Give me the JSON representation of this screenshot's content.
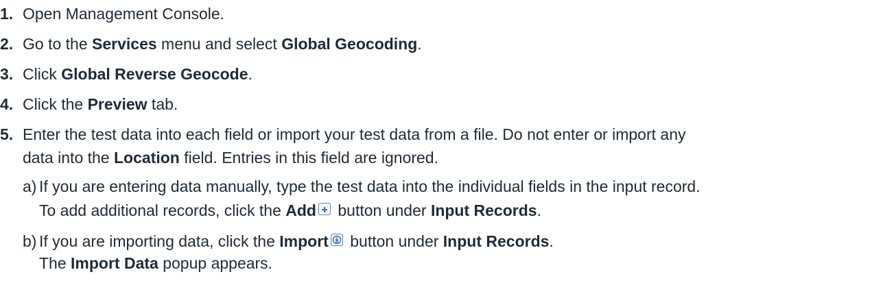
{
  "steps": [
    {
      "number": "1.",
      "parts": [
        {
          "t": "Open Management Console.",
          "b": false
        }
      ]
    },
    {
      "number": "2.",
      "parts": [
        {
          "t": "Go to the ",
          "b": false
        },
        {
          "t": "Services",
          "b": true
        },
        {
          "t": " menu and select ",
          "b": false
        },
        {
          "t": "Global Geocoding",
          "b": true
        },
        {
          "t": ".",
          "b": false
        }
      ]
    },
    {
      "number": "3.",
      "parts": [
        {
          "t": "Click ",
          "b": false
        },
        {
          "t": "Global Reverse Geocode",
          "b": true
        },
        {
          "t": ".",
          "b": false
        }
      ]
    },
    {
      "number": "4.",
      "parts": [
        {
          "t": "Click the ",
          "b": false
        },
        {
          "t": "Preview",
          "b": true
        },
        {
          "t": " tab.",
          "b": false
        }
      ]
    },
    {
      "number": "5.",
      "line1": "Enter the test data into each field or import your test data from a file. Do not enter or import any",
      "line2_a": "data into the ",
      "line2_b": "Location",
      "line2_c": " field. Entries in this field are ignored."
    }
  ],
  "substeps": {
    "a": {
      "letter": "a)",
      "line1": "If you are entering data manually, type the test data into the individual fields in the input record.",
      "line2_a": "To add additional records, click the ",
      "line2_b": "Add",
      "line2_c": " button under ",
      "line2_d": "Input Records",
      "line2_e": ".",
      "icon": "plus-icon"
    },
    "b": {
      "letter": "b)",
      "line1_a": "If you are importing data, click the ",
      "line1_b": "Import",
      "line1_c": " button under ",
      "line1_d": "Input Records",
      "line1_e": ".",
      "line2_a": "The ",
      "line2_b": "Import Data",
      "line2_c": " popup appears.",
      "icon": "import-icon"
    }
  },
  "colors": {
    "text": "#1f2a36",
    "icon_border": "#5b86b8",
    "icon_glyph": "#2f6db5"
  }
}
